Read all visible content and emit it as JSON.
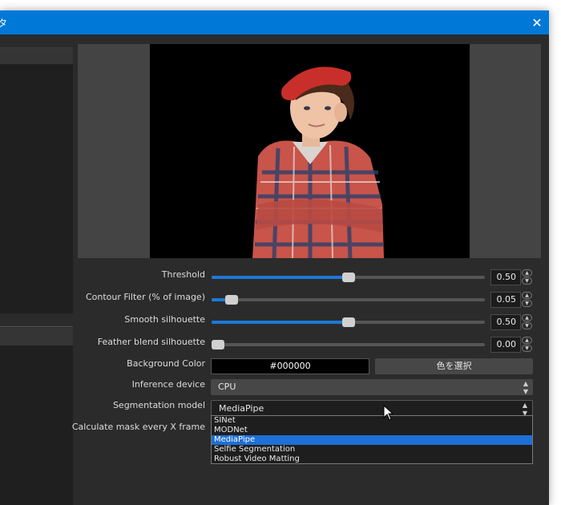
{
  "window": {
    "title_fragment": "タ",
    "close_glyph": "✕"
  },
  "controls": {
    "threshold": {
      "label": "Threshold",
      "value": "0.50",
      "fraction": 0.5
    },
    "contour": {
      "label": "Contour Filter (% of image)",
      "value": "0.05",
      "fraction": 0.05
    },
    "smooth": {
      "label": "Smooth silhouette",
      "value": "0.50",
      "fraction": 0.5
    },
    "feather": {
      "label": "Feather blend silhouette",
      "value": "0.00",
      "fraction": 0.0
    },
    "background_color": {
      "label": "Background Color",
      "value": "#000000",
      "button": "色を選択"
    },
    "inference": {
      "label": "Inference device",
      "value": "CPU"
    },
    "segmentation": {
      "label": "Segmentation model",
      "value": "MediaPipe",
      "options": [
        "SINet",
        "MODNet",
        "MediaPipe",
        "Selfie Segmentation",
        "Robust Video Matting"
      ],
      "selected_index": 2
    },
    "calc_mask": {
      "label": "Calculate mask every X frame"
    }
  },
  "colors": {
    "accent": "#0078d7",
    "slider_fill": "#1e79d6",
    "selected": "#1e6fd6",
    "window_bg": "#2b2b2b"
  }
}
